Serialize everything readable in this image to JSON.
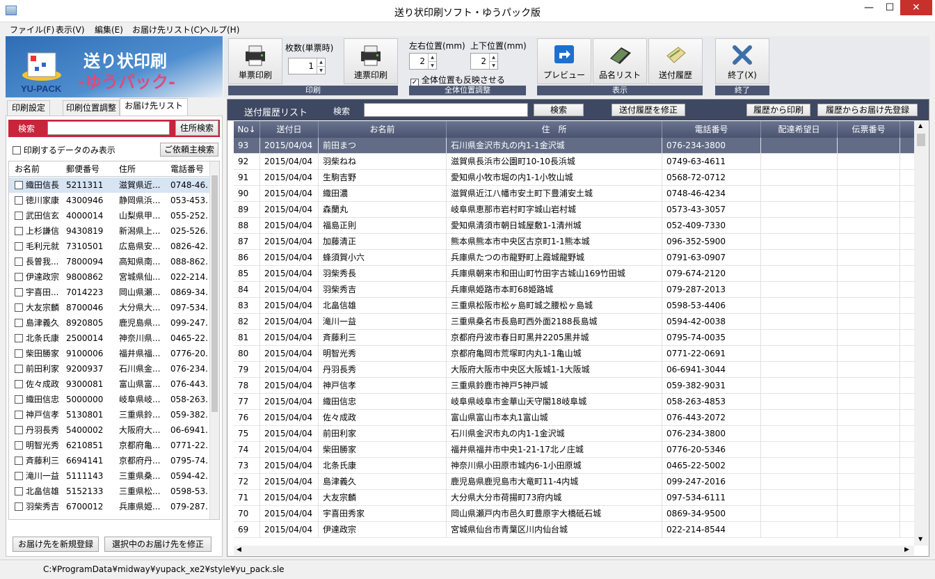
{
  "window": {
    "title": "送り状印刷ソフト・ゆうパック版",
    "minimize": "—",
    "maximize": "☐",
    "close": "✕"
  },
  "menu": [
    "ファイル(F)",
    "表示(V)",
    "編集(E)",
    "お届け先リスト(C)",
    "ヘルプ(H)"
  ],
  "banner": {
    "line1": "送り状印刷",
    "line2": "-ゆうパック-",
    "brand": "YU-PACK"
  },
  "ribbon": {
    "single_print": "単票印刷",
    "copies_label": "枚数(単票時)",
    "copies_value": "1",
    "continuous_print": "連票印刷",
    "group_print": "印刷",
    "lr_label": "左右位置(mm)",
    "lr_value": "2",
    "ud_label": "上下位置(mm)",
    "ud_value": "2",
    "reflect_all": "全体位置も反映させる",
    "group_position": "全体位置調整",
    "preview": "プレビュー",
    "item_list": "品名リスト",
    "send_history": "送付履歴",
    "group_display": "表示",
    "exit": "終了(X)",
    "group_exit": "終了"
  },
  "left": {
    "tabs": [
      "印刷設定",
      "印刷位置調整",
      "お届け先リスト"
    ],
    "search_label": "検索",
    "search_value": "",
    "address_search": "住所検索",
    "only_print": "印刷するデータのみ表示",
    "sender_search": "ご依頼主検索",
    "columns": [
      "お名前",
      "郵便番号",
      "住所",
      "電話番号"
    ],
    "rows": [
      [
        "織田信長",
        "5211311",
        "滋賀県近...",
        "0748-46."
      ],
      [
        "徳川家康",
        "4300946",
        "静岡県浜...",
        "053-453."
      ],
      [
        "武田信玄",
        "4000014",
        "山梨県甲...",
        "055-252."
      ],
      [
        "上杉謙信",
        "9430819",
        "新潟県上...",
        "025-526."
      ],
      [
        "毛利元就",
        "7310501",
        "広島県安...",
        "0826-42."
      ],
      [
        "長曽我...",
        "7800094",
        "高知県南...",
        "088-862."
      ],
      [
        "伊達政宗",
        "9800862",
        "宮城県仙...",
        "022-214."
      ],
      [
        "宇喜田...",
        "7014223",
        "岡山県瀬...",
        "0869-34."
      ],
      [
        "大友宗麟",
        "8700046",
        "大分県大...",
        "097-534."
      ],
      [
        "島津義久",
        "8920805",
        "鹿児島県...",
        "099-247."
      ],
      [
        "北条氏康",
        "2500014",
        "神奈川県...",
        "0465-22."
      ],
      [
        "柴田勝家",
        "9100006",
        "福井県福...",
        "0776-20."
      ],
      [
        "前田利家",
        "9200937",
        "石川県金...",
        "076-234."
      ],
      [
        "佐々成政",
        "9300081",
        "富山県富...",
        "076-443."
      ],
      [
        "織田信忠",
        "5000000",
        "岐阜県岐...",
        "058-263."
      ],
      [
        "神戸信孝",
        "5130801",
        "三重県鈴...",
        "059-382."
      ],
      [
        "丹羽長秀",
        "5400002",
        "大阪府大...",
        "06-6941."
      ],
      [
        "明智光秀",
        "6210851",
        "京都府亀...",
        "0771-22."
      ],
      [
        "斉藤利三",
        "6694141",
        "京都府丹...",
        "0795-74."
      ],
      [
        "滝川一益",
        "5111143",
        "三重県桑...",
        "0594-42."
      ],
      [
        "北畠信雄",
        "5152133",
        "三重県松...",
        "0598-53."
      ],
      [
        "羽柴秀吉",
        "6700012",
        "兵庫県姫...",
        "079-287."
      ]
    ],
    "new_register": "お届け先を新規登録",
    "edit_selected": "選択中のお届け先を修正"
  },
  "right": {
    "title": "送付履歴リスト",
    "search_label": "検索",
    "search_value": "",
    "search_btn": "検索",
    "edit_btn": "送付履歴を修正",
    "print_from_history": "履歴から印刷",
    "register_from_history": "履歴からお届け先登録",
    "columns": [
      "No↓",
      "送付日",
      "お名前",
      "住　所",
      "電話番号",
      "配達希望日",
      "伝票番号"
    ],
    "rows": [
      [
        "93",
        "2015/04/04",
        "前田まつ",
        "石川県金沢市丸の内1-1金沢城",
        "076-234-3800"
      ],
      [
        "92",
        "2015/04/04",
        "羽柴ねね",
        "滋賀県長浜市公園町10-10長浜城",
        "0749-63-4611"
      ],
      [
        "91",
        "2015/04/04",
        "生駒吉野",
        "愛知県小牧市堀の内1-1小牧山城",
        "0568-72-0712"
      ],
      [
        "90",
        "2015/04/04",
        "織田濃",
        "滋賀県近江八幡市安土町下豊浦安土城",
        "0748-46-4234"
      ],
      [
        "89",
        "2015/04/04",
        "森蘭丸",
        "岐阜県恵那市岩村町字城山岩村城",
        "0573-43-3057"
      ],
      [
        "88",
        "2015/04/04",
        "福島正則",
        "愛知県清須市朝日城屋敷1-1清州城",
        "052-409-7330"
      ],
      [
        "87",
        "2015/04/04",
        "加藤清正",
        "熊本県熊本市中央区古京町1-1熊本城",
        "096-352-5900"
      ],
      [
        "86",
        "2015/04/04",
        "蜂須賀小六",
        "兵庫県たつの市龍野町上霞城龍野城",
        "0791-63-0907"
      ],
      [
        "85",
        "2015/04/04",
        "羽柴秀長",
        "兵庫県朝来市和田山町竹田字古城山169竹田城",
        "079-674-2120"
      ],
      [
        "84",
        "2015/04/04",
        "羽柴秀吉",
        "兵庫県姫路市本町68姫路城",
        "079-287-2013"
      ],
      [
        "83",
        "2015/04/04",
        "北畠信雄",
        "三重県松阪市松ヶ島町城之腰松ヶ島城",
        "0598-53-4406"
      ],
      [
        "82",
        "2015/04/04",
        "滝川一益",
        "三重県桑名市長島町西外面2188長島城",
        "0594-42-0038"
      ],
      [
        "81",
        "2015/04/04",
        "斉藤利三",
        "京都府丹波市春日町黒井2205黒井城",
        "0795-74-0035"
      ],
      [
        "80",
        "2015/04/04",
        "明智光秀",
        "京都府亀岡市荒塚町内丸1-1亀山城",
        "0771-22-0691"
      ],
      [
        "79",
        "2015/04/04",
        "丹羽長秀",
        "大阪府大阪市中央区大阪城1-1大阪城",
        "06-6941-3044"
      ],
      [
        "78",
        "2015/04/04",
        "神戸信孝",
        "三重県鈴鹿市神戸5神戸城",
        "059-382-9031"
      ],
      [
        "77",
        "2015/04/04",
        "織田信忠",
        "岐阜県岐阜市金華山天守閣18岐阜城",
        "058-263-4853"
      ],
      [
        "76",
        "2015/04/04",
        "佐々成政",
        "富山県富山市本丸1富山城",
        "076-443-2072"
      ],
      [
        "75",
        "2015/04/04",
        "前田利家",
        "石川県金沢市丸の内1-1金沢城",
        "076-234-3800"
      ],
      [
        "74",
        "2015/04/04",
        "柴田勝家",
        "福井県福井市中央1-21-17北ノ庄城",
        "0776-20-5346"
      ],
      [
        "73",
        "2015/04/04",
        "北条氏康",
        "神奈川県小田原市城内6-1小田原城",
        "0465-22-5002"
      ],
      [
        "72",
        "2015/04/04",
        "島津義久",
        "鹿児島県鹿児島市大竜町11-4内城",
        "099-247-2016"
      ],
      [
        "71",
        "2015/04/04",
        "大友宗麟",
        "大分県大分市荷揚町73府内城",
        "097-534-6111"
      ],
      [
        "70",
        "2015/04/04",
        "宇喜田秀家",
        "岡山県瀬戸内市邑久町豊原字大橋砥石城",
        "0869-34-9500"
      ],
      [
        "69",
        "2015/04/04",
        "伊達政宗",
        "宮城県仙台市青葉区川内仙台城",
        "022-214-8544"
      ]
    ]
  },
  "status": "C:¥ProgramData¥midway¥yupack_xe2¥style¥yu_pack.sle",
  "colors": {
    "accent": "#c8243b",
    "header": "#3e4862",
    "selected": "#626c86"
  }
}
